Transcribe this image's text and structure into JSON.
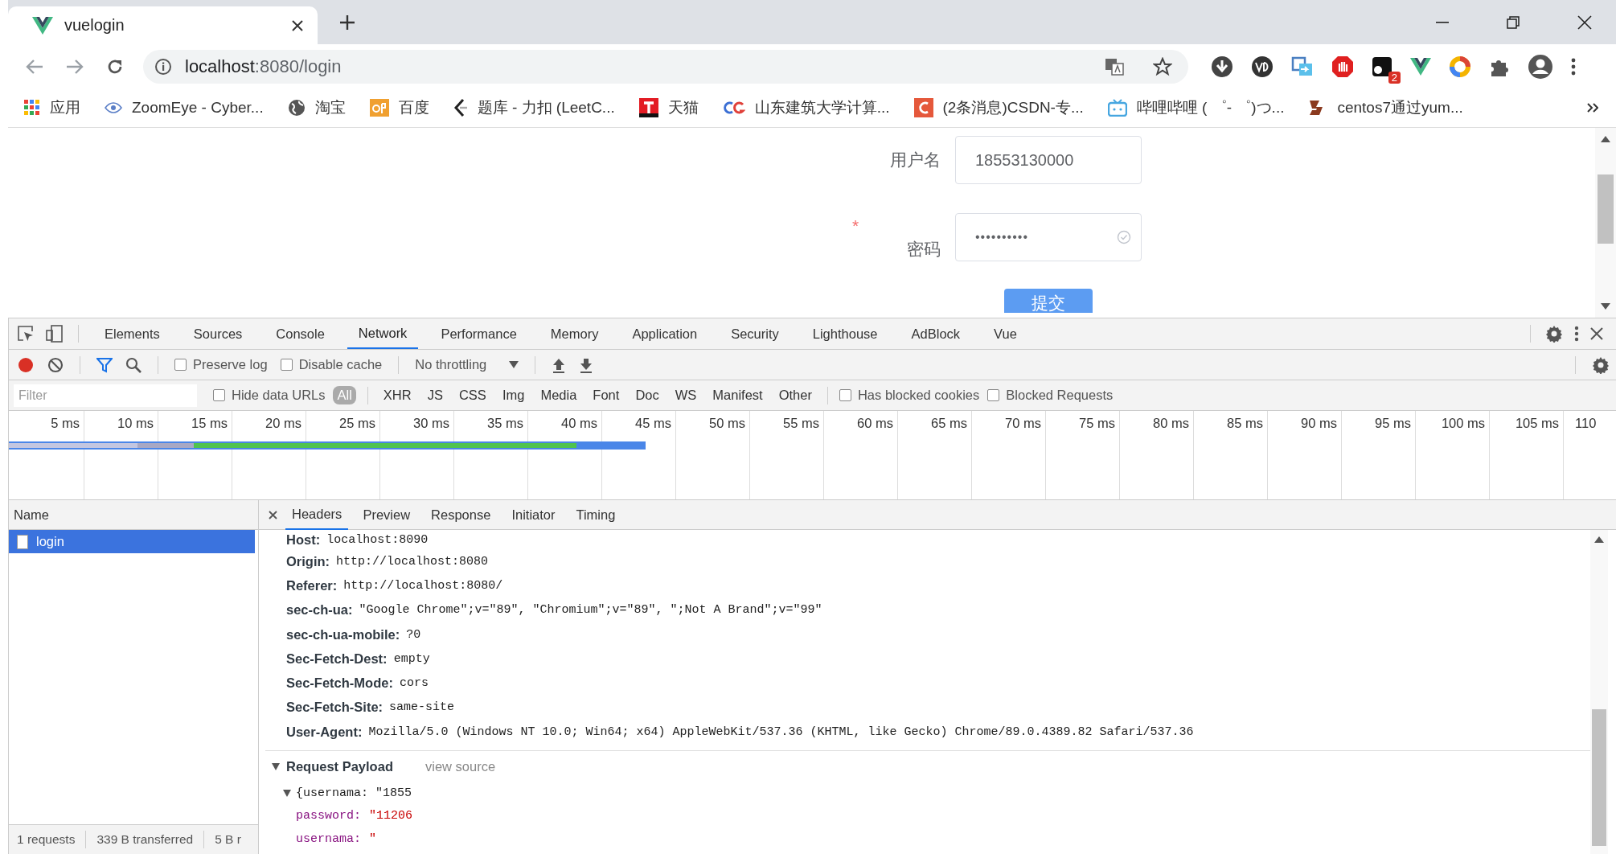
{
  "browser_tab": {
    "title": "vuelogin"
  },
  "address_bar": {
    "host": "localhost",
    "path": ":8080/login"
  },
  "extension_badge": "2",
  "bookmarks": [
    {
      "label": "应用",
      "kind": "apps"
    },
    {
      "label": "ZoomEye - Cyber...",
      "kind": "eye"
    },
    {
      "label": "淘宝",
      "kind": "globe"
    },
    {
      "label": "百度",
      "kind": "ep"
    },
    {
      "label": "题库 - 力扣 (LeetC...",
      "kind": "leet"
    },
    {
      "label": "天猫",
      "kind": "tmall"
    },
    {
      "label": "山东建筑大学计算...",
      "kind": "cg"
    },
    {
      "label": "(2条消息)CSDN-专...",
      "kind": "c"
    },
    {
      "label": "哔哩哔哩 ( ゜- ゜)つ...",
      "kind": "tv"
    },
    {
      "label": "centos7通过yum...",
      "kind": "b"
    }
  ],
  "login_form": {
    "fields": [
      {
        "label": "用户名",
        "kind": "text",
        "value": "18553130000"
      },
      {
        "label": "密码",
        "kind": "password",
        "required_mark": "*",
        "value": "••••••••••"
      }
    ],
    "submit": "提交"
  },
  "devtools_tabs": [
    {
      "label": "Elements",
      "selected": false
    },
    {
      "label": "Sources",
      "selected": false
    },
    {
      "label": "Console",
      "selected": false
    },
    {
      "label": "Network",
      "selected": true
    },
    {
      "label": "Performance",
      "selected": false
    },
    {
      "label": "Memory",
      "selected": false
    },
    {
      "label": "Application",
      "selected": false
    },
    {
      "label": "Security",
      "selected": false
    },
    {
      "label": "Lighthouse",
      "selected": false
    },
    {
      "label": "AdBlock",
      "selected": false
    },
    {
      "label": "Vue",
      "selected": false
    }
  ],
  "toolbar": {
    "recording": true,
    "preserve_log": {
      "label": "Preserve log",
      "checked": false
    },
    "disable_cache": {
      "label": "Disable cache",
      "checked": false
    },
    "throttling": "No throttling"
  },
  "filter_bar": {
    "placeholder": "Filter",
    "hide_data_urls": {
      "label": "Hide data URLs",
      "checked": false
    },
    "types": [
      {
        "label": "All",
        "selected": true
      },
      {
        "label": "XHR",
        "selected": false
      },
      {
        "label": "JS",
        "selected": false
      },
      {
        "label": "CSS",
        "selected": false
      },
      {
        "label": "Img",
        "selected": false
      },
      {
        "label": "Media",
        "selected": false
      },
      {
        "label": "Font",
        "selected": false
      },
      {
        "label": "Doc",
        "selected": false
      },
      {
        "label": "WS",
        "selected": false
      },
      {
        "label": "Manifest",
        "selected": false
      },
      {
        "label": "Other",
        "selected": false
      }
    ],
    "has_blocked_cookies": {
      "label": "Has blocked cookies",
      "checked": false
    },
    "blocked_requests": {
      "label": "Blocked Requests",
      "checked": false
    }
  },
  "timeline_ticks": [
    "5 ms",
    "10 ms",
    "15 ms",
    "20 ms",
    "25 ms",
    "30 ms",
    "35 ms",
    "40 ms",
    "45 ms",
    "50 ms",
    "55 ms",
    "60 ms",
    "65 ms",
    "70 ms",
    "75 ms",
    "80 ms",
    "85 ms",
    "90 ms",
    "95 ms",
    "100 ms",
    "105 ms",
    "110"
  ],
  "requests": {
    "column": "Name",
    "rows": [
      {
        "name": "login",
        "selected": true
      }
    ]
  },
  "detail_tabs": [
    {
      "label": "Headers",
      "selected": true
    },
    {
      "label": "Preview",
      "selected": false
    },
    {
      "label": "Response",
      "selected": false
    },
    {
      "label": "Initiator",
      "selected": false
    },
    {
      "label": "Timing",
      "selected": false
    }
  ],
  "headers": [
    {
      "name": "Host:",
      "value": "localhost:8090"
    },
    {
      "name": "Origin:",
      "value": "http://localhost:8080"
    },
    {
      "name": "Referer:",
      "value": "http://localhost:8080/"
    },
    {
      "name": "sec-ch-ua:",
      "value": "\"Google Chrome\";v=\"89\", \"Chromium\";v=\"89\", \";Not A Brand\";v=\"99\""
    },
    {
      "name": "sec-ch-ua-mobile:",
      "value": "?0"
    },
    {
      "name": "Sec-Fetch-Dest:",
      "value": "empty"
    },
    {
      "name": "Sec-Fetch-Mode:",
      "value": "cors"
    },
    {
      "name": "Sec-Fetch-Site:",
      "value": "same-site"
    },
    {
      "name": "User-Agent:",
      "value": "Mozilla/5.0 (Windows NT 10.0; Win64; x64) AppleWebKit/537.36 (KHTML, like Gecko) Chrome/89.0.4389.82 Safari/537.36"
    }
  ],
  "payload": {
    "title": "Request Payload",
    "view_source": "view source",
    "expanded": true,
    "summary": "{usernama: \"1855",
    "fields": [
      {
        "key": "password:",
        "value": "\"11206"
      },
      {
        "key": "usernama:",
        "value": "\""
      }
    ]
  },
  "status_bar": [
    "1 requests",
    "339 B transferred",
    "5 B r"
  ]
}
